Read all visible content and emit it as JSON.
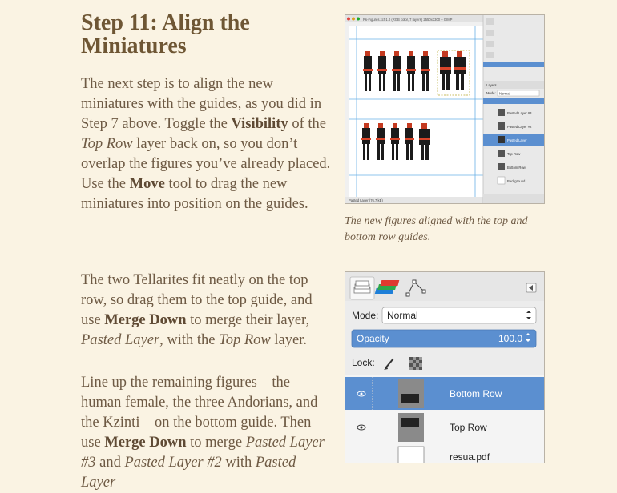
{
  "heading": "Step 11: Align the Miniatures",
  "para1": {
    "t1": "The next step is to align the new miniatures with the guides, as you did in Step 7 above. Toggle the ",
    "b1": "Visibility",
    "t2": " of the ",
    "i1": "Top Row",
    "t3": " layer back on, so you don’t overlap the figures you’ve already placed. Use the ",
    "b2": "Move",
    "t4": " tool to drag the new miniatures into position on the guides."
  },
  "caption": "The new figures aligned with the top and bottom row guides.",
  "para2": {
    "t1": "The two Tellarites fit neatly on the top row, so drag them to the top guide, and use ",
    "b1": "Merge Down",
    "t2": " to merge their layer, ",
    "i1": "Pasted Layer",
    "t3": ", with the ",
    "i2": "Top Row",
    "t4": " layer."
  },
  "para3": {
    "t1": "Line up the remaining figures—the human female, the three Andorians, and the Kzinti—on the bottom guide. Then use ",
    "b1": "Merge Down",
    "t2": " to merge ",
    "i1": "Pasted Layer #3",
    "t3": " and ",
    "i2": "Pasted Layer #2",
    "t4": " with ",
    "i3": "Pasted Layer"
  },
  "figure1": {
    "window_title": "Rk-Figures.xcf-1.0 (RGB color, 7 layers) 2550x3300 – GIMP",
    "status": "Pasted Layer (76.7 kB)",
    "mode_label": "Mode:",
    "mode_value": "Normal",
    "layers_tab": "Layers",
    "layers": [
      "Pasted Layer #3",
      "Pasted Layer #2",
      "Pasted Layer",
      "Top Row",
      "Bottom Row",
      "Background"
    ]
  },
  "figure2": {
    "mode_label": "Mode:",
    "mode_value": "Normal",
    "opacity_label": "Opacity",
    "opacity_value": "100.0",
    "lock_label": "Lock:",
    "layers": [
      "Bottom Row",
      "Top Row",
      "resua.pdf"
    ]
  },
  "colors": {
    "background": "#faf3e3",
    "heading": "#6e5634",
    "text": "#6e5a44",
    "selection": "#5b8fd0"
  }
}
